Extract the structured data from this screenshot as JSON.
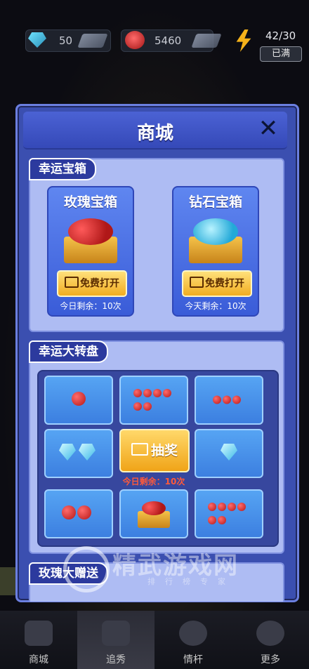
{
  "resources": {
    "gems": "50",
    "roses": "5460",
    "stamina": "42/30",
    "stamina_status": "已满"
  },
  "modal": {
    "title": "商城",
    "close_symbol": "✕",
    "lucky_box": {
      "tag": "幸运宝箱",
      "boxes": [
        {
          "title": "玫瑰宝箱",
          "button": "免费打开",
          "remain": "今日剩余：10次"
        },
        {
          "title": "钻石宝箱",
          "button": "免费打开",
          "remain": "今天剩余：10次"
        }
      ]
    },
    "lucky_wheel": {
      "tag": "幸运大转盘",
      "draw_button": "抽奖",
      "remain": "今日剩余：10次"
    },
    "rose_gift": {
      "tag": "玫瑰大赠送"
    }
  },
  "watermark": {
    "text": "精武游戏网",
    "sub": "排行榜专家"
  },
  "bottom_nav": [
    {
      "label": "商城",
      "icon": "shop-cart-icon"
    },
    {
      "label": "追秀",
      "icon": "horse-icon"
    },
    {
      "label": "情杆",
      "icon": "wheel-icon"
    },
    {
      "label": "更多",
      "icon": "more-icon"
    }
  ]
}
